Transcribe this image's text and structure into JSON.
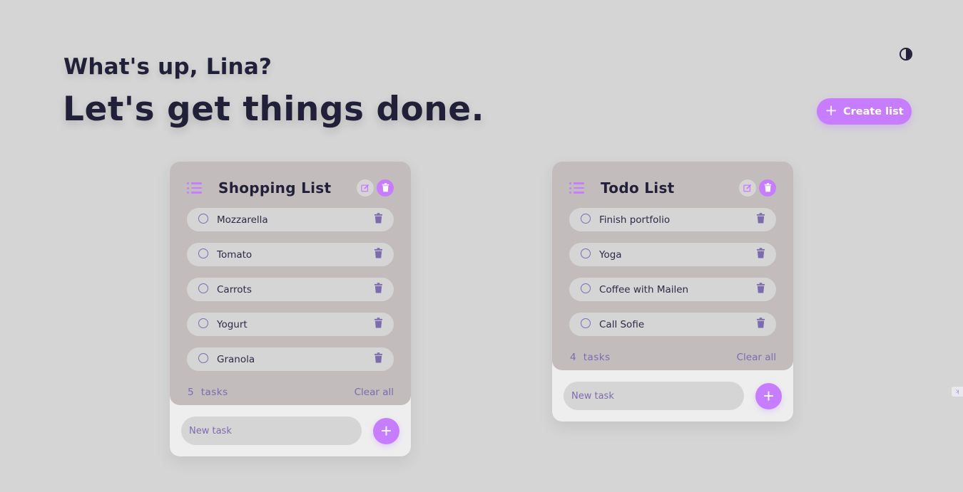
{
  "header": {
    "greeting": "What's up, Lina?",
    "headline": "Let's get things done."
  },
  "toolbar": {
    "theme_toggle_icon": "contrast-icon",
    "create_list_label": "Create list",
    "create_list_icon": "plus-icon"
  },
  "colors": {
    "accent": "#c77dff",
    "text_dark": "#221f39",
    "muted_purple": "#7c6cae",
    "background": "#d5d5d5",
    "card_top": "#c2bcbc"
  },
  "lists": [
    {
      "title": "Shopping List",
      "tasks": [
        "Mozzarella",
        "Tomato",
        "Carrots",
        "Yogurt",
        "Granola"
      ],
      "count": "5",
      "count_label": "tasks",
      "clear_label": "Clear all",
      "new_task_placeholder": "New task"
    },
    {
      "title": "Todo List",
      "tasks": [
        "Finish portfolio",
        "Yoga",
        "Coffee with Mailen",
        "Call Sofie"
      ],
      "count": "4",
      "count_label": "tasks",
      "clear_label": "Clear all",
      "new_task_placeholder": "New task"
    }
  ]
}
